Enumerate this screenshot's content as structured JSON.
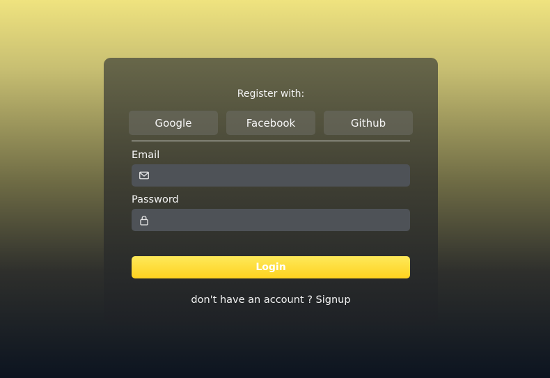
{
  "register": {
    "title": "Register with:",
    "providers": [
      {
        "label": "Google"
      },
      {
        "label": "Facebook"
      },
      {
        "label": "Github"
      }
    ]
  },
  "form": {
    "email": {
      "label": "Email",
      "value": "",
      "placeholder": "",
      "icon": "envelope-icon"
    },
    "password": {
      "label": "Password",
      "value": "",
      "placeholder": "",
      "icon": "lock-icon"
    },
    "login_label": "Login"
  },
  "footer": {
    "prompt": "don't have an account ? ",
    "signup_label": "Signup"
  },
  "colors": {
    "accent": "#ffd21f",
    "card": "#3c3c32",
    "field": "#4e5257"
  }
}
